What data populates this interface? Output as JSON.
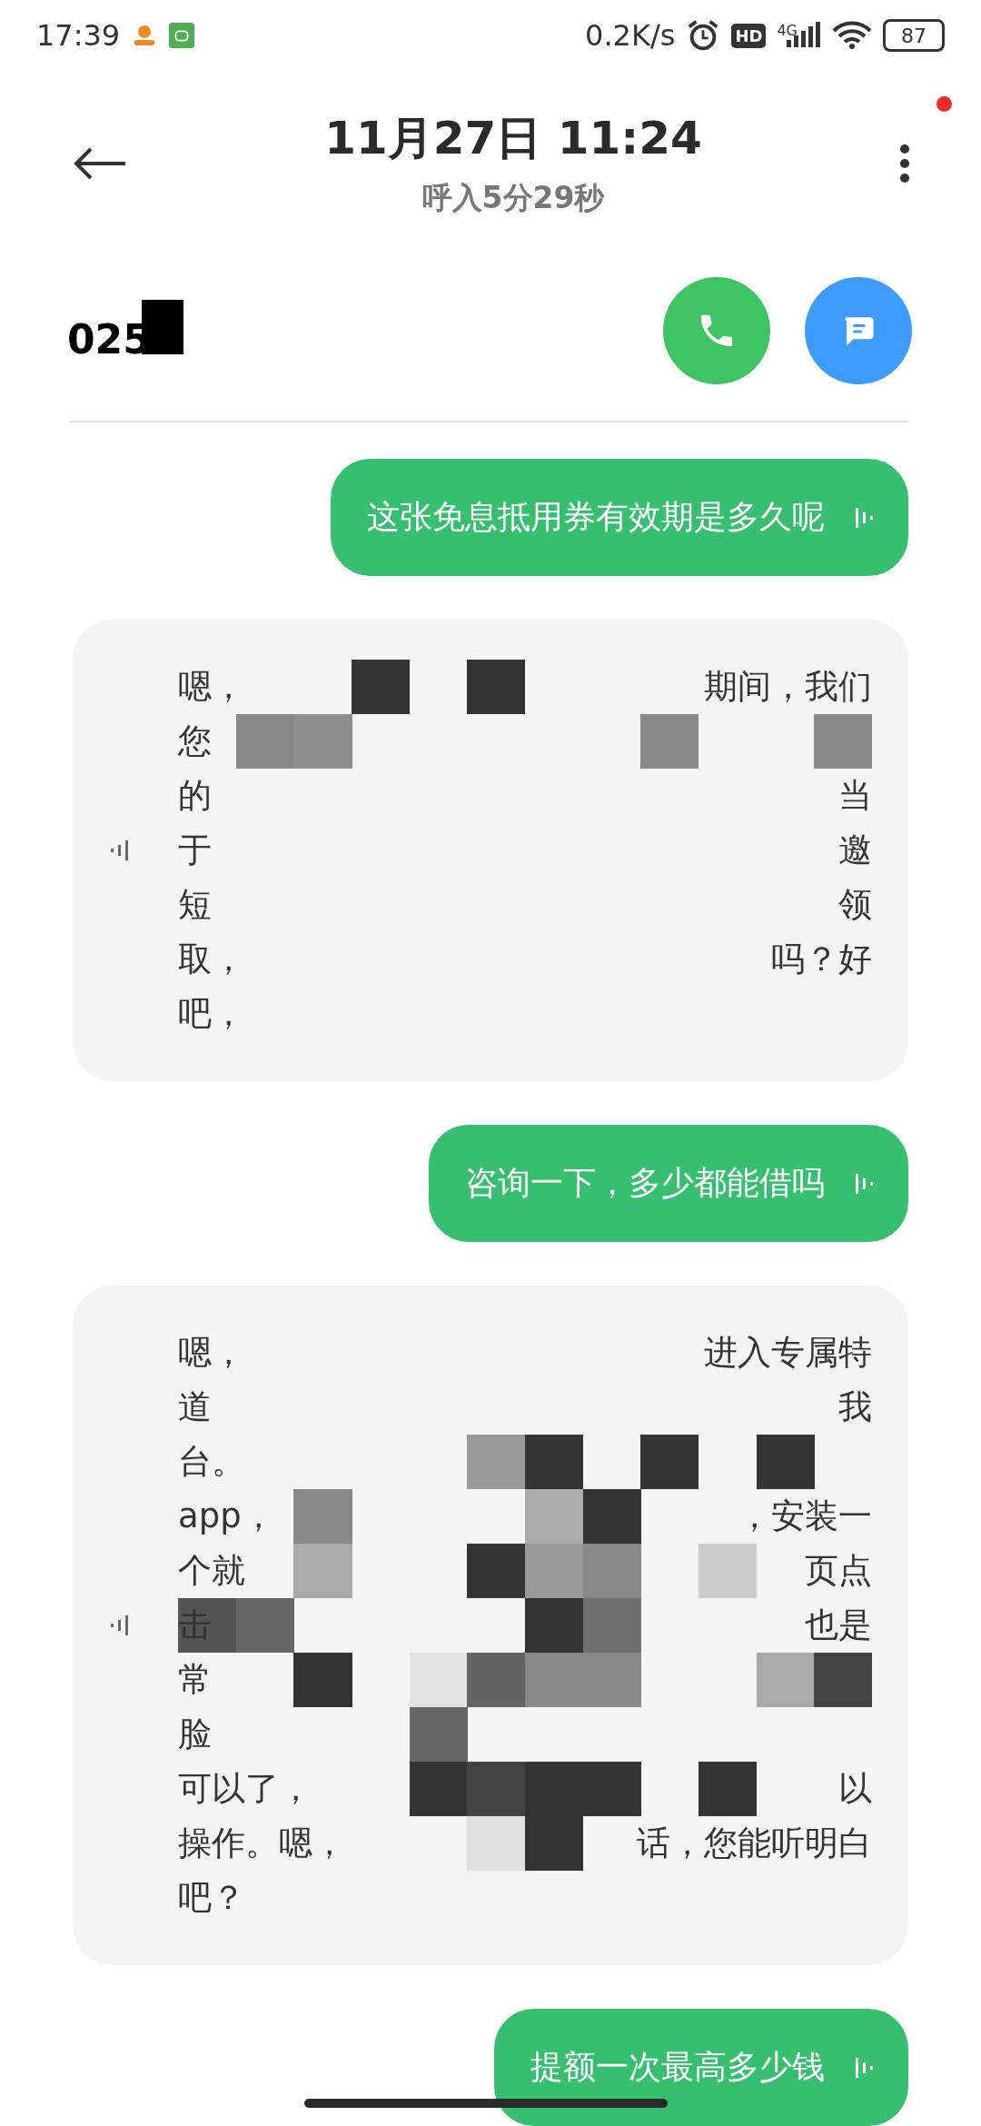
{
  "status_bar": {
    "time": "17:39",
    "net_speed": "0.2K/s",
    "hd": "HD",
    "network": "4G",
    "battery": "87"
  },
  "header": {
    "title": "11月27日 11:24",
    "subtitle": "呼入5分29秒",
    "menu_badge": true
  },
  "caller": {
    "number": "025"
  },
  "messages": [
    {
      "kind": "outgoing",
      "lines": [
        [
          "这张免息抵用券有效期是多久呢"
        ]
      ]
    },
    {
      "kind": "incoming",
      "lines": [
        [
          "嗯，",
          "期间，我们"
        ],
        [
          "您"
        ],
        [
          "的",
          "当"
        ],
        [
          "于",
          "邀"
        ],
        [
          "短",
          "领"
        ],
        [
          "取，",
          "吗？好"
        ],
        [
          "吧，"
        ]
      ]
    },
    {
      "kind": "outgoing",
      "lines": [
        [
          "咨询一下，多少都能借吗"
        ]
      ]
    },
    {
      "kind": "incoming",
      "lines": [
        [
          "嗯，",
          "进入专属特"
        ],
        [
          "道",
          "我"
        ],
        [
          "台。"
        ],
        [
          "app，",
          "，安装一"
        ],
        [
          "个就",
          "页点"
        ],
        [
          "击",
          "也是"
        ],
        [
          "常"
        ],
        [
          "脸"
        ],
        [
          "可以了，",
          "以"
        ],
        [
          "操作。嗯，",
          "话，您能听明白"
        ],
        [
          "吧？"
        ]
      ]
    },
    {
      "kind": "outgoing",
      "lines": [
        [
          "提额一次最高多少钱"
        ]
      ]
    }
  ]
}
